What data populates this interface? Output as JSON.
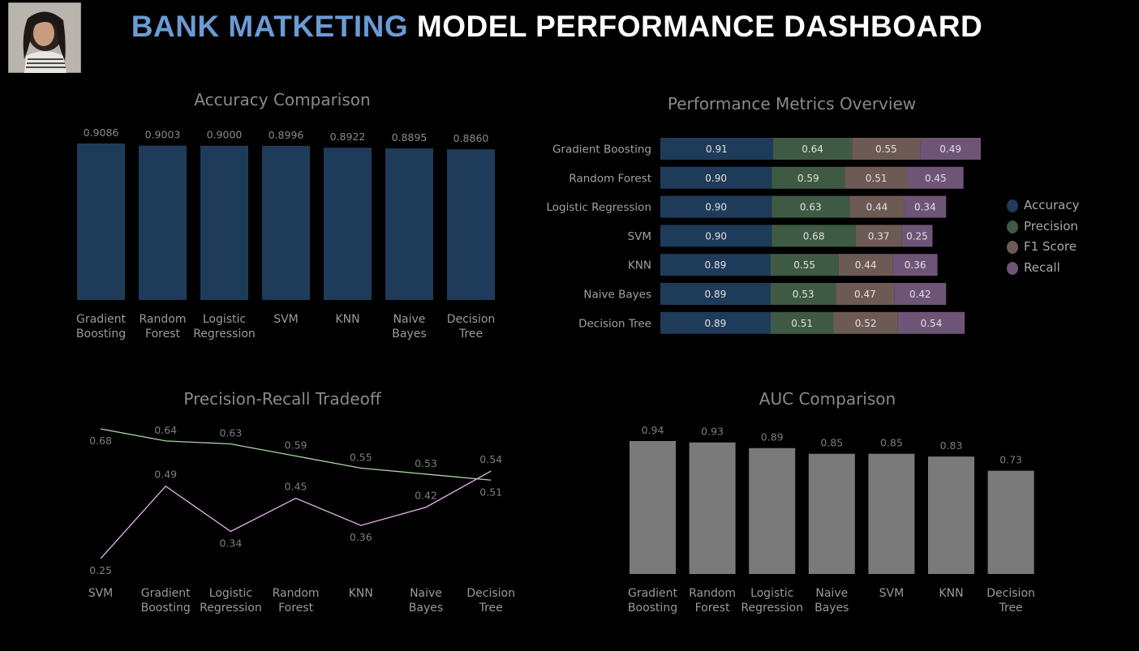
{
  "header": {
    "title_part1": "BANK MATKETING",
    "title_part2": "MODEL PERFORMANCE DASHBOARD",
    "avatar_icon": "user-photo-avatar"
  },
  "colors": {
    "background": "#000000",
    "title_accent": "#6b9bd6",
    "accuracy": "#1f3b5a",
    "precision": "#3e5a44",
    "f1": "#6e5a55",
    "recall": "#6e5577",
    "auc_bar": "#7a7a7a",
    "precision_line": "#a8d7a0",
    "recall_line": "#e3b4ec"
  },
  "chart_data": [
    {
      "id": "accuracy",
      "type": "bar",
      "title": "Accuracy Comparison",
      "categories": [
        [
          "Gradient",
          "Boosting"
        ],
        [
          "Random",
          "Forest"
        ],
        [
          "Logistic",
          "Regression"
        ],
        [
          "SVM"
        ],
        [
          "KNN"
        ],
        [
          "Naive",
          "Bayes"
        ],
        [
          "Decision",
          "Tree"
        ]
      ],
      "values": [
        0.9086,
        0.9003,
        0.9,
        0.8996,
        0.8922,
        0.8895,
        0.886
      ],
      "value_labels": [
        "0.9086",
        "0.9003",
        "0.9000",
        "0.8996",
        "0.8922",
        "0.8895",
        "0.8860"
      ],
      "ylim": [
        0.3,
        0.9086
      ]
    },
    {
      "id": "metrics",
      "type": "bar",
      "orientation": "horizontal",
      "stacked": true,
      "title": "Performance Metrics Overview",
      "categories": [
        "Gradient Boosting",
        "Random Forest",
        "Logistic Regression",
        "SVM",
        "KNN",
        "Naive Bayes",
        "Decision Tree"
      ],
      "series": [
        {
          "name": "Accuracy",
          "values": [
            0.91,
            0.9,
            0.9,
            0.9,
            0.89,
            0.89,
            0.89
          ]
        },
        {
          "name": "Precision",
          "values": [
            0.64,
            0.59,
            0.63,
            0.68,
            0.55,
            0.53,
            0.51
          ]
        },
        {
          "name": "F1 Score",
          "values": [
            0.55,
            0.51,
            0.44,
            0.37,
            0.44,
            0.47,
            0.52
          ]
        },
        {
          "name": "Recall",
          "values": [
            0.49,
            0.45,
            0.34,
            0.25,
            0.36,
            0.42,
            0.54
          ]
        }
      ],
      "value_labels": [
        [
          "0.91",
          "0.64",
          "0.55",
          "0.49"
        ],
        [
          "0.90",
          "0.59",
          "0.51",
          "0.45"
        ],
        [
          "0.90",
          "0.63",
          "0.44",
          "0.34"
        ],
        [
          "0.90",
          "0.68",
          "0.37",
          "0.25"
        ],
        [
          "0.89",
          "0.55",
          "0.44",
          "0.36"
        ],
        [
          "0.89",
          "0.53",
          "0.47",
          "0.42"
        ],
        [
          "0.89",
          "0.51",
          "0.52",
          "0.54"
        ]
      ],
      "legend": [
        "Accuracy",
        "Precision",
        "F1 Score",
        "Recall"
      ],
      "legend_position": "right"
    },
    {
      "id": "pr",
      "type": "line",
      "title": "Precision-Recall Tradeoff",
      "categories": [
        [
          "SVM"
        ],
        [
          "Gradient",
          "Boosting"
        ],
        [
          "Logistic",
          "Regression"
        ],
        [
          "Random",
          "Forest"
        ],
        [
          "KNN"
        ],
        [
          "Naive",
          "Bayes"
        ],
        [
          "Decision",
          "Tree"
        ]
      ],
      "series": [
        {
          "values": [
            0.68,
            0.64,
            0.63,
            0.59,
            0.55,
            0.53,
            0.51
          ],
          "labels": [
            "0.68",
            "0.64",
            "0.63",
            "0.59",
            "0.55",
            "0.53",
            "0.51"
          ]
        },
        {
          "values": [
            0.25,
            0.49,
            0.34,
            0.45,
            0.36,
            0.42,
            0.54
          ],
          "labels": [
            "0.25",
            "0.49",
            "0.34",
            "0.45",
            "0.36",
            "0.42",
            "0.54"
          ]
        }
      ],
      "ylim": [
        0.25,
        0.68
      ]
    },
    {
      "id": "auc",
      "type": "bar",
      "title": "AUC Comparison",
      "categories": [
        [
          "Gradient",
          "Boosting"
        ],
        [
          "Random",
          "Forest"
        ],
        [
          "Logistic",
          "Regression"
        ],
        [
          "Naive",
          "Bayes"
        ],
        [
          "SVM"
        ],
        [
          "KNN"
        ],
        [
          "Decision",
          "Tree"
        ]
      ],
      "values": [
        0.94,
        0.93,
        0.89,
        0.85,
        0.85,
        0.83,
        0.73
      ],
      "value_labels": [
        "0.94",
        "0.93",
        "0.89",
        "0.85",
        "0.85",
        "0.83",
        "0.73"
      ],
      "ylim": [
        0.0,
        0.94
      ]
    }
  ]
}
